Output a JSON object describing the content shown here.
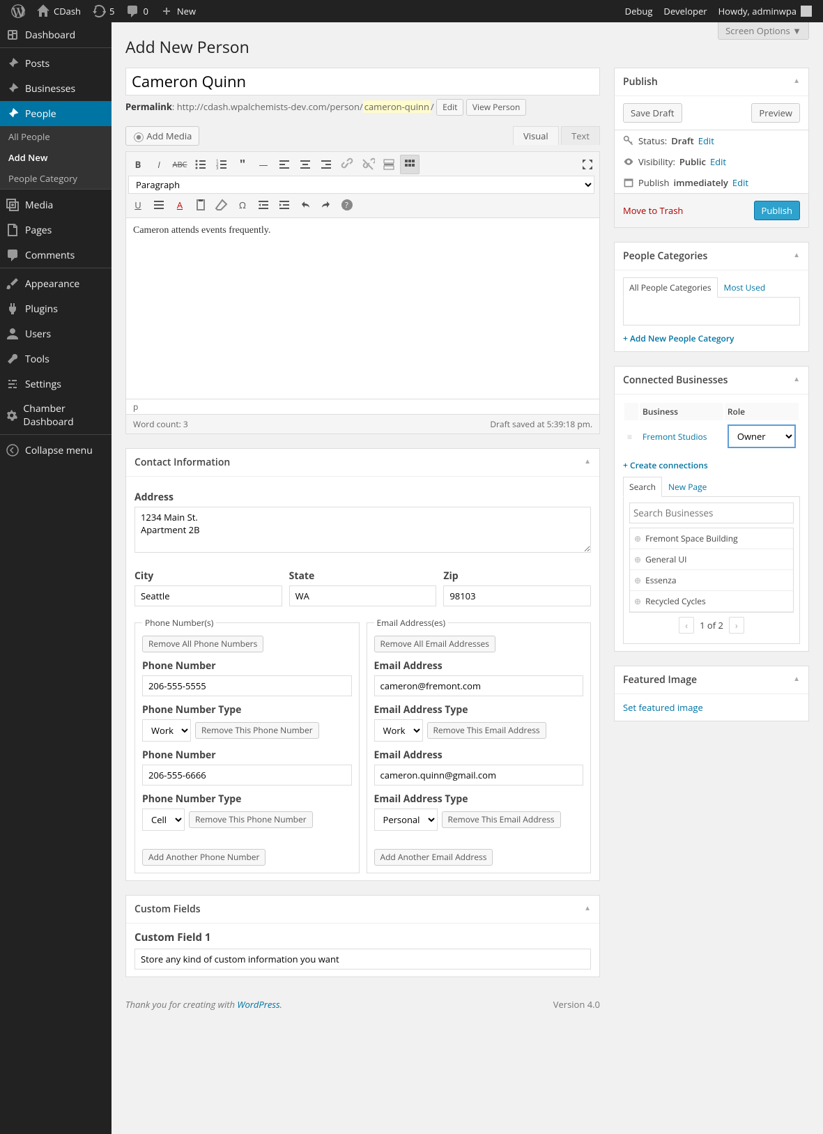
{
  "adminbar": {
    "site_name": "CDash",
    "updates": "5",
    "comments": "0",
    "new": "New",
    "debug": "Debug",
    "developer": "Developer",
    "howdy": "Howdy, adminwpa"
  },
  "sidebar": {
    "dashboard": "Dashboard",
    "posts": "Posts",
    "businesses": "Businesses",
    "people": "People",
    "sub_all": "All People",
    "sub_add": "Add New",
    "sub_cat": "People Category",
    "media": "Media",
    "pages": "Pages",
    "comments": "Comments",
    "appearance": "Appearance",
    "plugins": "Plugins",
    "users": "Users",
    "tools": "Tools",
    "settings": "Settings",
    "chamber": "Chamber Dashboard",
    "collapse": "Collapse menu"
  },
  "screen_options": "Screen Options",
  "page_title": "Add New Person",
  "title_input": "Cameron Quinn",
  "permalink": {
    "label": "Permalink",
    "url_base": "http://cdash.wpalchemists-dev.com/person/",
    "slug": "cameron-quinn",
    "edit": "Edit",
    "view": "View Person"
  },
  "editor": {
    "add_media": "Add Media",
    "visual": "Visual",
    "text": "Text",
    "paragraph": "Paragraph",
    "content": "Cameron attends events frequently.",
    "path": "p",
    "word_count_label": "Word count: 3",
    "draft_saved": "Draft saved at 5:39:18 pm."
  },
  "publish": {
    "title": "Publish",
    "save_draft": "Save Draft",
    "preview": "Preview",
    "status_label": "Status:",
    "status": "Draft",
    "visibility_label": "Visibility:",
    "visibility": "Public",
    "publish_label": "Publish",
    "publish_val": "immediately",
    "edit": "Edit",
    "trash": "Move to Trash",
    "button": "Publish"
  },
  "categories": {
    "title": "People Categories",
    "tab_all": "All People Categories",
    "tab_most": "Most Used",
    "add_link": "+ Add New People Category"
  },
  "connected": {
    "title": "Connected Businesses",
    "col_biz": "Business",
    "col_role": "Role",
    "row_biz": "Fremont Studios",
    "row_role": "Owner",
    "create": "+ Create connections",
    "tab_search": "Search",
    "tab_new": "New Page",
    "search_ph": "Search Businesses",
    "results": [
      "Fremont Space Building",
      "General UI",
      "Essenza",
      "Recycled Cycles"
    ],
    "pager": "1 of 2"
  },
  "featured": {
    "title": "Featured Image",
    "link": "Set featured image"
  },
  "contact": {
    "title": "Contact Information",
    "address_label": "Address",
    "address": "1234 Main St.\nApartment 2B",
    "city_label": "City",
    "city": "Seattle",
    "state_label": "State",
    "state": "WA",
    "zip_label": "Zip",
    "zip": "98103",
    "phone_legend": "Phone Number(s)",
    "remove_all_phone": "Remove All Phone Numbers",
    "phone_label": "Phone Number",
    "phone_type_label": "Phone Number Type",
    "remove_phone": "Remove This Phone Number",
    "add_phone": "Add Another Phone Number",
    "phone1": "206-555-5555",
    "phone1_type": "Work",
    "phone2": "206-555-6666",
    "phone2_type": "Cell",
    "email_legend": "Email Address(es)",
    "remove_all_email": "Remove All Email Addresses",
    "email_label": "Email Address",
    "email_type_label": "Email Address Type",
    "remove_email": "Remove This Email Address",
    "add_email": "Add Another Email Address",
    "email1": "cameron@fremont.com",
    "email1_type": "Work",
    "email2": "cameron.quinn@gmail.com",
    "email2_type": "Personal"
  },
  "custom": {
    "title": "Custom Fields",
    "field1": "Custom Field 1",
    "value1": "Store any kind of custom information you want"
  },
  "footer": {
    "thanks": "Thank you for creating with ",
    "wp": "WordPress",
    "version": "Version 4.0"
  }
}
